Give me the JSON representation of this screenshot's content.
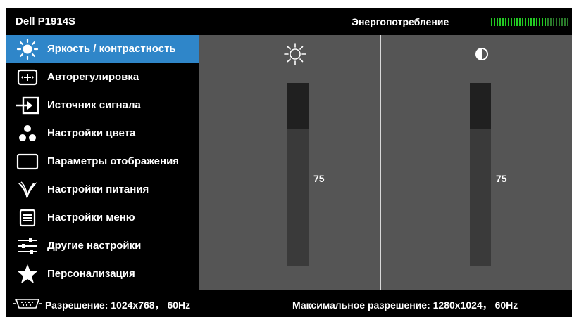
{
  "header": {
    "model": "Dell P1914S",
    "energy_label": "Энергопотребление",
    "energy_meter": {
      "level": 0.72,
      "active_color": "#22cc22",
      "inactive_color": "#2a7a2a"
    }
  },
  "sidebar": {
    "items": [
      {
        "label": "Яркость / контрастность",
        "icon": "brightness-icon",
        "selected": true
      },
      {
        "label": "Авторегулировка",
        "icon": "auto-adjust-icon",
        "selected": false
      },
      {
        "label": "Источник сигнала",
        "icon": "input-source-icon",
        "selected": false
      },
      {
        "label": "Настройки цвета",
        "icon": "color-settings-icon",
        "selected": false
      },
      {
        "label": "Параметры отображения",
        "icon": "display-settings-icon",
        "selected": false
      },
      {
        "label": "Настройки питания",
        "icon": "power-settings-icon",
        "selected": false
      },
      {
        "label": "Настройки меню",
        "icon": "menu-settings-icon",
        "selected": false
      },
      {
        "label": "Другие настройки",
        "icon": "other-settings-icon",
        "selected": false
      },
      {
        "label": "Персонализация",
        "icon": "personalize-icon",
        "selected": false
      }
    ]
  },
  "controls": {
    "brightness": {
      "icon": "sun-icon",
      "value": "75",
      "level": 0.75
    },
    "contrast": {
      "icon": "contrast-icon",
      "value": "75",
      "level": 0.75
    }
  },
  "footer": {
    "resolution": "Разрешение: 1024x768， 60Hz",
    "max_resolution": "Максимальное разрешение: 1280x1024， 60Hz"
  },
  "colors": {
    "accent": "#2f86c9",
    "panel": "#555555",
    "background": "#000000"
  }
}
